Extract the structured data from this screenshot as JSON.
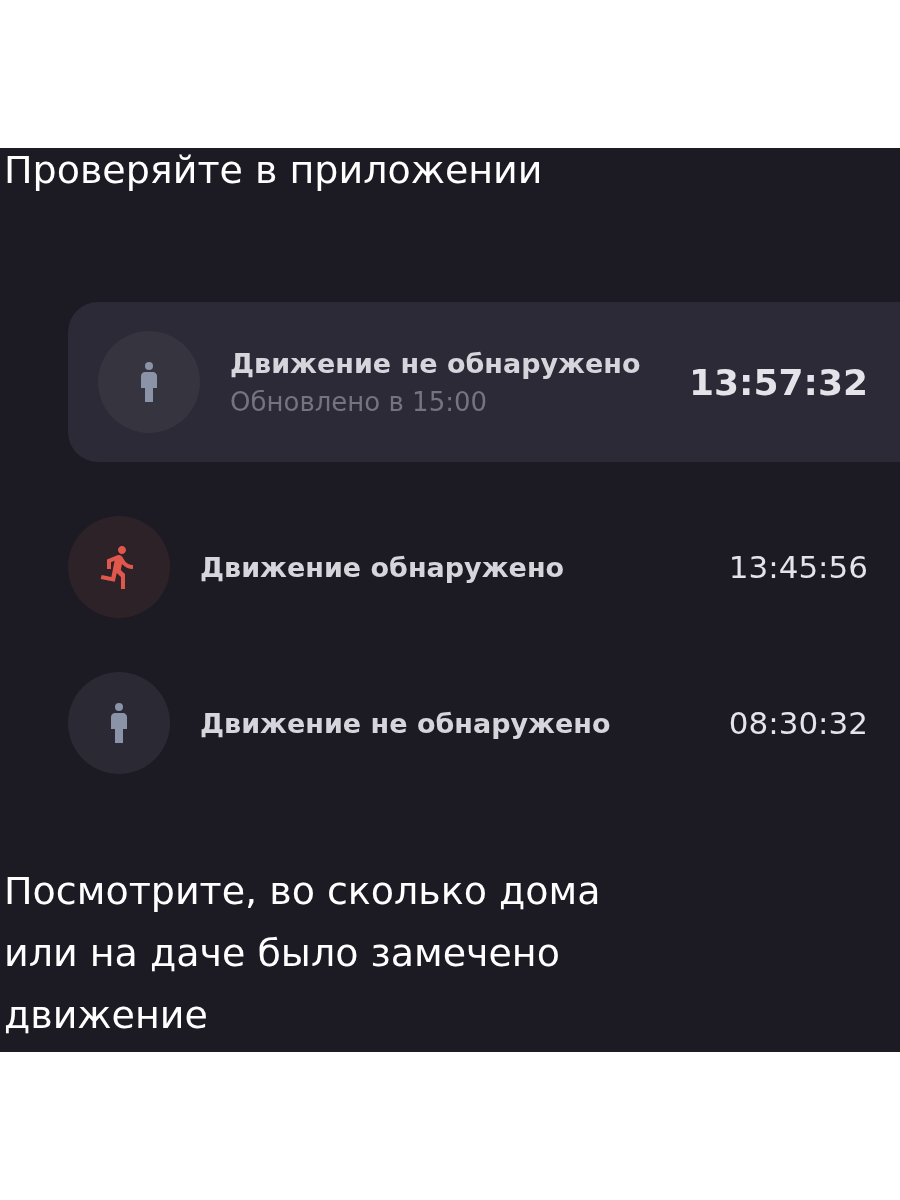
{
  "heading": "Проверяйте в приложении",
  "events": [
    {
      "kind": "still",
      "highlighted": true,
      "title": "Движение не обнаружено",
      "subtitle": "Обновлено в 15:00",
      "time": "13:57:32"
    },
    {
      "kind": "motion",
      "highlighted": false,
      "title": "Движение обнаружено",
      "time": "13:45:56"
    },
    {
      "kind": "still",
      "highlighted": false,
      "title": "Движение не обнаружено",
      "time": "08:30:32"
    }
  ],
  "caption": "Посмотрите, во сколько дома или на даче было замечено движение"
}
